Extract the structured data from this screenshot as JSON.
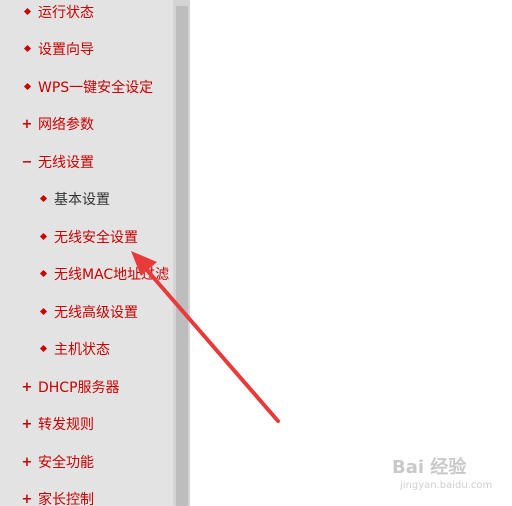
{
  "sidebar": {
    "items": [
      {
        "label": "运行状态",
        "marker": "dot",
        "level": 0
      },
      {
        "label": "设置向导",
        "marker": "dot",
        "level": 0
      },
      {
        "label": "WPS一键安全设定",
        "marker": "dot",
        "level": 0
      },
      {
        "label": "网络参数",
        "marker": "plus",
        "level": 0
      },
      {
        "label": "无线设置",
        "marker": "minus",
        "level": 0
      },
      {
        "label": "基本设置",
        "marker": "dot",
        "level": 1,
        "active": true
      },
      {
        "label": "无线安全设置",
        "marker": "dot",
        "level": 1
      },
      {
        "label": "无线MAC地址过滤",
        "marker": "dot",
        "level": 1
      },
      {
        "label": "无线高级设置",
        "marker": "dot",
        "level": 1
      },
      {
        "label": "主机状态",
        "marker": "dot",
        "level": 1
      },
      {
        "label": "DHCP服务器",
        "marker": "plus",
        "level": 0
      },
      {
        "label": "转发规则",
        "marker": "plus",
        "level": 0
      },
      {
        "label": "安全功能",
        "marker": "plus",
        "level": 0
      },
      {
        "label": "家长控制",
        "marker": "plus",
        "level": 0
      }
    ]
  },
  "colors": {
    "menu_text": "#cc0000",
    "active_text": "#333333",
    "sidebar_bg": "#e3e3e3",
    "arrow": "#e83a3a"
  },
  "watermark": {
    "brand": "Bai 经验",
    "sub": "jingyan.baidu.com"
  }
}
